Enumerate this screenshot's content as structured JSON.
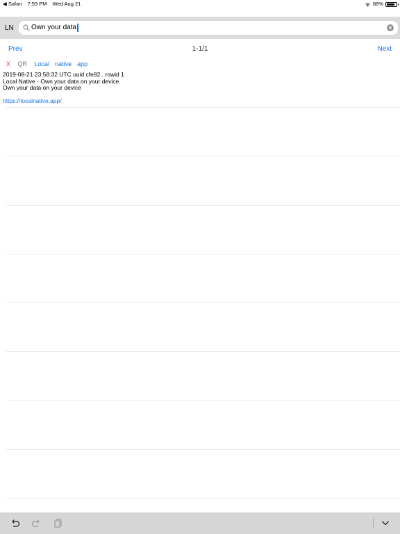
{
  "status_bar": {
    "back_app": "◀ Safari",
    "time": "7:59 PM",
    "date": "Wed Aug 21",
    "battery": "88%",
    "battery_level": 0.88
  },
  "header": {
    "app_label": "LN",
    "search": {
      "value": "Own your data",
      "placeholder": ""
    }
  },
  "pager": {
    "prev_label": "Prev",
    "page_indicator": "1-1/1",
    "next_label": "Next"
  },
  "note": {
    "delete_label": "X",
    "qr_label": "QR",
    "tags": [
      "Local",
      "native",
      "app"
    ],
    "meta": "2019-08-21 23:58:32 UTC uuid cfe82.. rowid 1",
    "annotation": "Local Native - Own your data on your device.",
    "text": "Own your data on your device",
    "url": "https://localnative.app/"
  },
  "icons": {
    "undo": "undo-icon",
    "redo": "redo-icon",
    "paste": "clipboard-icon",
    "dismiss": "chevron-down-icon"
  },
  "colors": {
    "accent": "#1a73e8",
    "delete": "#e53935"
  }
}
